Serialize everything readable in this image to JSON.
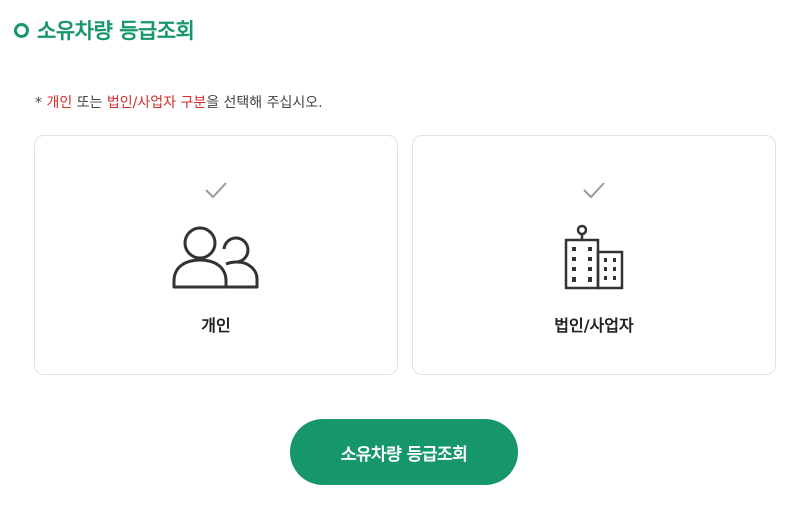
{
  "header": {
    "title": "소유차량 등급조회"
  },
  "notice": {
    "prefix": "* ",
    "option_individual": "개인",
    "connector": " 또는 ",
    "option_corporate": "법인/사업자 구분",
    "suffix": "을 선택해 주십시오."
  },
  "options": [
    {
      "label": "개인",
      "icon": "people-icon"
    },
    {
      "label": "법인/사업자",
      "icon": "building-icon"
    }
  ],
  "submit": {
    "label": "소유차량 등급조회"
  },
  "colors": {
    "accent": "#16976b",
    "highlight": "#d0312d",
    "check": "#9a9a9a"
  }
}
